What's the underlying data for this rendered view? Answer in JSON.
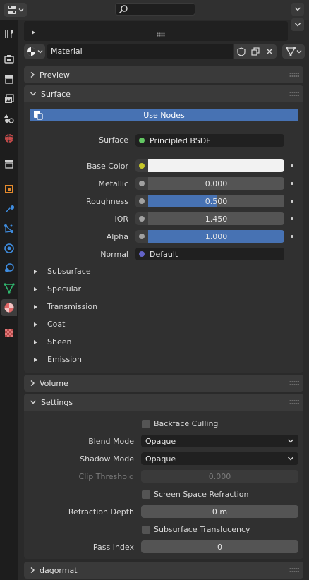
{
  "colors": {
    "accent": "#4772b3",
    "socket_green": "#63c763",
    "socket_yellow": "#c7c729",
    "socket_gray": "#a1a1a1",
    "socket_violet": "#6363c7",
    "panel_header": "#3a3a3a"
  },
  "header": {
    "editor_icon": "properties-editor-icon",
    "search_icon": "search-icon"
  },
  "tabs": [
    {
      "name": "tool-tab",
      "icon": "wrench-screwdriver-icon"
    },
    {
      "name": "render-tab",
      "icon": "camera-back-icon"
    },
    {
      "name": "output-tab",
      "icon": "printer-icon"
    },
    {
      "name": "view-layer-tab",
      "icon": "images-icon"
    },
    {
      "name": "scene-tab",
      "icon": "scene-shapes-icon"
    },
    {
      "name": "world-tab",
      "icon": "globe-icon"
    },
    {
      "name": "collection-tab",
      "icon": "box-icon"
    },
    {
      "name": "object-tab",
      "icon": "orange-square-icon"
    },
    {
      "name": "modifiers-tab",
      "icon": "wrench-icon"
    },
    {
      "name": "particles-tab",
      "icon": "particles-icon"
    },
    {
      "name": "physics-tab",
      "icon": "physics-orbit-icon"
    },
    {
      "name": "constraints-tab",
      "icon": "constraint-icon"
    },
    {
      "name": "data-tab",
      "icon": "mesh-triangle-icon"
    },
    {
      "name": "material-tab",
      "icon": "material-sphere-icon"
    },
    {
      "name": "texture-tab",
      "icon": "checker-icon"
    }
  ],
  "material": {
    "name": "Material"
  },
  "panels": {
    "preview": "Preview",
    "surface": "Surface",
    "volume": "Volume",
    "settings": "Settings",
    "dagormat": "dagormat"
  },
  "surface": {
    "use_nodes": "Use Nodes",
    "surface_label": "Surface",
    "surface_value": "Principled BSDF",
    "base_color_label": "Base Color",
    "metallic_label": "Metallic",
    "metallic_value": "0.000",
    "metallic_fraction": 0.0,
    "roughness_label": "Roughness",
    "roughness_value": "0.500",
    "roughness_fraction": 0.5,
    "ior_label": "IOR",
    "ior_value": "1.450",
    "alpha_label": "Alpha",
    "alpha_value": "1.000",
    "alpha_fraction": 1.0,
    "normal_label": "Normal",
    "normal_value": "Default",
    "subsections": [
      "Subsurface",
      "Specular",
      "Transmission",
      "Coat",
      "Sheen",
      "Emission"
    ]
  },
  "settings": {
    "backface_culling": "Backface Culling",
    "blend_mode_label": "Blend Mode",
    "blend_mode_value": "Opaque",
    "shadow_mode_label": "Shadow Mode",
    "shadow_mode_value": "Opaque",
    "clip_threshold_label": "Clip Threshold",
    "clip_threshold_value": "0.000",
    "ssr": "Screen Space Refraction",
    "refraction_depth_label": "Refraction Depth",
    "refraction_depth_value": "0 m",
    "subsurface_translucency": "Subsurface Translucency",
    "pass_index_label": "Pass Index",
    "pass_index_value": "0"
  }
}
